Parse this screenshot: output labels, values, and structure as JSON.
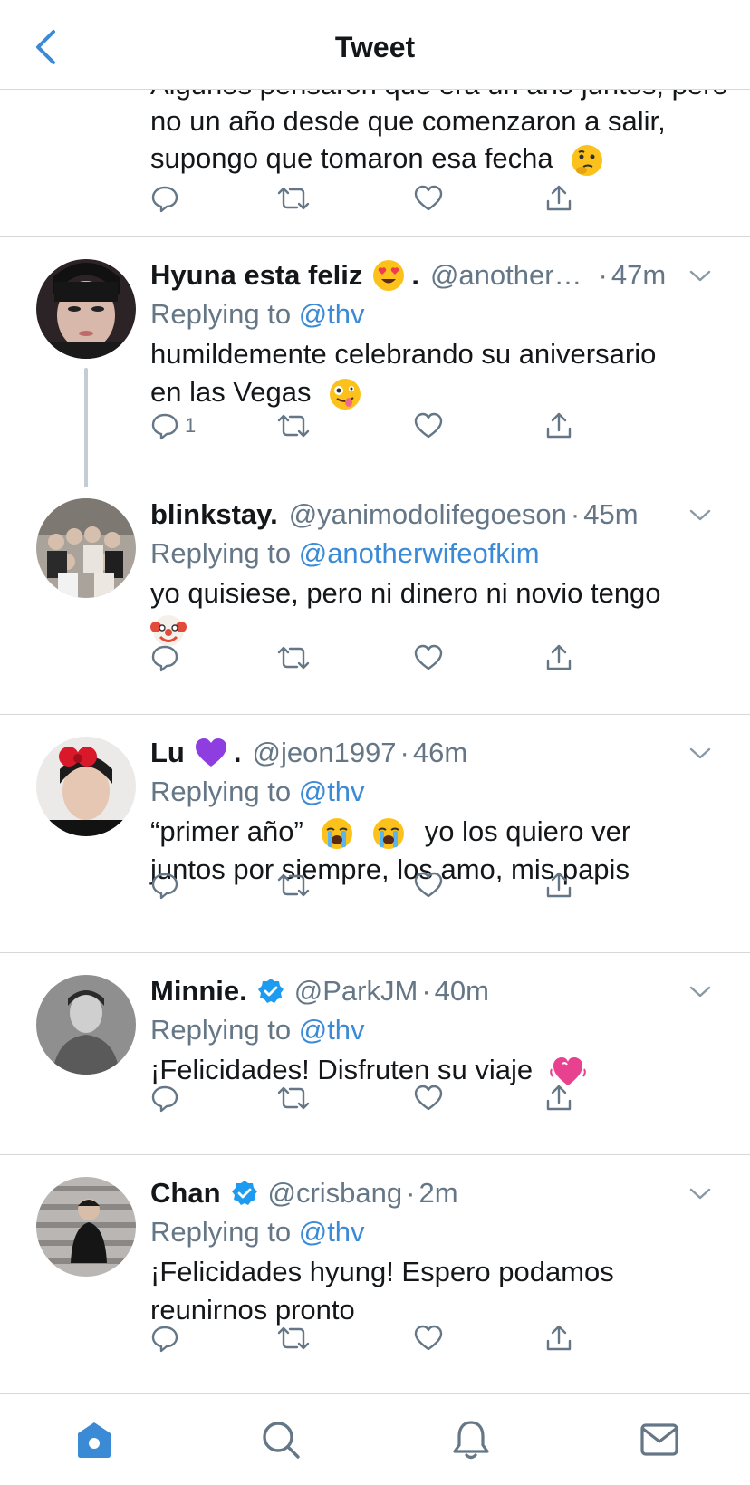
{
  "header": {
    "title": "Tweet"
  },
  "partial_tweet": {
    "cut_text": "Algunos pensaron que era un año juntos, pero",
    "lines": [
      "no un año desde que comenzaron a salir,",
      "supongo que tomaron esa fecha"
    ],
    "emoji": "thinking-face"
  },
  "tweets": [
    {
      "name": "Hyuna esta feliz",
      "name_suffix": ".",
      "handle": "@another…",
      "dot": "·",
      "time": "47m",
      "reply_prefix": "Replying to ",
      "reply_to": "@thv",
      "lines": [
        "humildemente celebrando su aniversario",
        "en las Vegas"
      ],
      "reply_count": "1",
      "avatar_color": "#2b2326"
    },
    {
      "name": "blinkstay.",
      "handle": "@yanimodolifegoeson",
      "dot": "·",
      "time": "45m",
      "reply_prefix": "Replying to ",
      "reply_to": "@anotherwifeofkim",
      "lines": [
        "yo quisiese, pero ni dinero ni novio tengo"
      ],
      "avatar_color": "#8a857f"
    },
    {
      "name": "Lu",
      "name_suffix": ".",
      "handle": "@jeon1997",
      "dot": "·",
      "time": "46m",
      "reply_prefix": "Replying to ",
      "reply_to": "@thv",
      "lines": [
        "“primer año”",
        "yo los quiero ver",
        "juntos por siempre, los amo, mis papis"
      ],
      "avatar_color": "#e9e7e5"
    },
    {
      "name": "Minnie.",
      "handle": "@ParkJM",
      "dot": "·",
      "time": "40m",
      "reply_prefix": "Replying to ",
      "reply_to": "@thv",
      "lines": [
        "¡Felicidades! Disfruten su viaje"
      ],
      "avatar_color": "#7a7a7a"
    },
    {
      "name": "Chan",
      "handle": "@crisbang",
      "dot": "·",
      "time": "2m",
      "reply_prefix": "Replying to ",
      "reply_to": "@thv",
      "lines": [
        "¡Felicidades hyung! Espero podamos",
        "reunirnos pronto"
      ],
      "avatar_color": "#9a9795"
    }
  ],
  "colors": {
    "accent": "#3a8ad6",
    "secondary_text": "#657786",
    "icon": "#657786",
    "divider": "#d6d9dc",
    "verified": "#1d9bf0"
  },
  "tabbar": [
    "home-icon",
    "search-icon",
    "notifications-icon",
    "messages-icon"
  ]
}
